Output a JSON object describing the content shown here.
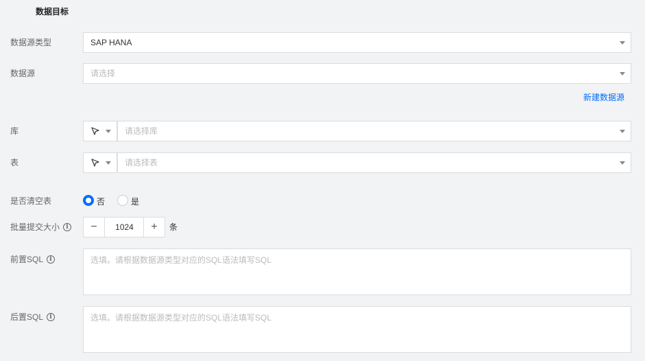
{
  "header": {
    "title": "数据目标"
  },
  "datasource_type": {
    "label": "数据源类型",
    "value": "SAP HANA"
  },
  "datasource": {
    "label": "数据源",
    "placeholder": "请选择"
  },
  "new_datasource_link": "新建数据源",
  "database": {
    "label": "库",
    "placeholder": "请选择库"
  },
  "table": {
    "label": "表",
    "placeholder": "请选择表"
  },
  "clear_table": {
    "label": "是否清空表",
    "options": [
      "否",
      "是"
    ],
    "selected": "否"
  },
  "batch_size": {
    "label": "批量提交大小",
    "value": "1024",
    "unit": "条",
    "minus": "−",
    "plus": "+"
  },
  "pre_sql": {
    "label": "前置SQL",
    "placeholder": "选填。请根据数据源类型对应的SQL语法填写SQL"
  },
  "post_sql": {
    "label": "后置SQL",
    "placeholder": "选填。请根据数据源类型对应的SQL语法填写SQL"
  },
  "icons": {
    "info": "i",
    "pointer": "cursor-pointer-icon"
  },
  "colors": {
    "accent": "#006eff",
    "border": "#dcdcdc",
    "background": "#f2f3f5"
  }
}
